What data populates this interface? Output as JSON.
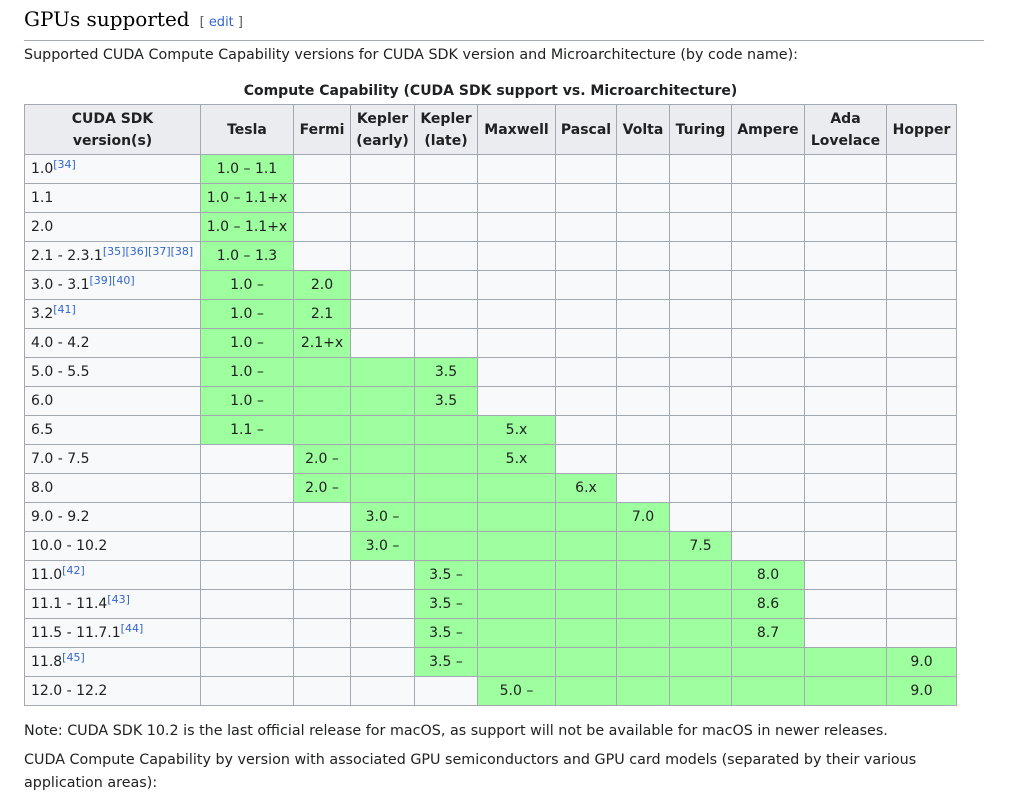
{
  "section": {
    "title": "GPUs supported",
    "edit_open": "[ ",
    "edit_label": "edit",
    "edit_close": " ]"
  },
  "intro": "Supported CUDA Compute Capability versions for CUDA SDK version and Microarchitecture (by code name):",
  "table": {
    "caption": "Compute Capability (CUDA SDK support vs. Microarchitecture)",
    "headers": [
      [
        "CUDA SDK",
        "version(s)"
      ],
      [
        "Tesla"
      ],
      [
        "Fermi"
      ],
      [
        "Kepler",
        "(early)"
      ],
      [
        "Kepler",
        "(late)"
      ],
      [
        "Maxwell"
      ],
      [
        "Pascal"
      ],
      [
        "Volta"
      ],
      [
        "Turing"
      ],
      [
        "Ampere"
      ],
      [
        "Ada",
        "Lovelace"
      ],
      [
        "Hopper"
      ]
    ],
    "highlight_color": "#9eff9e",
    "rows": [
      {
        "version": "1.0",
        "refs": [
          "[34]"
        ],
        "cells": [
          [
            "1.0 – 1.1",
            1,
            true
          ]
        ],
        "empty_after": 10
      },
      {
        "version": "1.1",
        "refs": [],
        "cells": [
          [
            "1.0 – 1.1+x",
            1,
            true
          ]
        ],
        "empty_after": 10
      },
      {
        "version": "2.0",
        "refs": [],
        "cells": [
          [
            "1.0 – 1.1+x",
            1,
            true
          ]
        ],
        "empty_after": 10
      },
      {
        "version": "2.1 - 2.3.1",
        "refs": [
          "[35]",
          "[36]",
          "[37]",
          "[38]"
        ],
        "cells": [
          [
            "1.0 – 1.3",
            1,
            true
          ]
        ],
        "empty_after": 10
      },
      {
        "version": "3.0 - 3.1",
        "refs": [
          "[39]",
          "[40]"
        ],
        "cells": [
          [
            "1.0 –",
            1,
            true
          ],
          [
            "2.0",
            1,
            true
          ]
        ],
        "empty_after": 9
      },
      {
        "version": "3.2",
        "refs": [
          "[41]"
        ],
        "cells": [
          [
            "1.0 –",
            1,
            true
          ],
          [
            "2.1",
            1,
            true
          ]
        ],
        "empty_after": 9
      },
      {
        "version": "4.0 - 4.2",
        "refs": [],
        "cells": [
          [
            "1.0 –",
            1,
            true
          ],
          [
            "2.1+x",
            1,
            true
          ]
        ],
        "empty_after": 9
      },
      {
        "version": "5.0 - 5.5",
        "refs": [],
        "cells": [
          [
            "1.0 –",
            1,
            true
          ],
          [
            "",
            2,
            true
          ],
          [
            "3.5",
            1,
            true
          ]
        ],
        "empty_after": 7
      },
      {
        "version": "6.0",
        "refs": [],
        "cells": [
          [
            "1.0 –",
            1,
            true
          ],
          [
            "",
            2,
            true
          ],
          [
            "3.5",
            1,
            true
          ]
        ],
        "empty_after": 7
      },
      {
        "version": "6.5",
        "refs": [],
        "cells": [
          [
            "1.1 –",
            1,
            true
          ],
          [
            "",
            3,
            true
          ],
          [
            "5.x",
            1,
            true
          ]
        ],
        "empty_after": 6
      },
      {
        "version": "7.0 - 7.5",
        "refs": [],
        "cells": [
          [
            "",
            1,
            false
          ],
          [
            "2.0 –",
            1,
            true
          ],
          [
            "",
            2,
            true
          ],
          [
            "5.x",
            1,
            true
          ]
        ],
        "empty_after": 6
      },
      {
        "version": "8.0",
        "refs": [],
        "cells": [
          [
            "",
            1,
            false
          ],
          [
            "2.0 –",
            1,
            true
          ],
          [
            "",
            3,
            true
          ],
          [
            "6.x",
            1,
            true
          ]
        ],
        "empty_after": 5
      },
      {
        "version": "9.0 - 9.2",
        "refs": [],
        "cells": [
          [
            "",
            2,
            false
          ],
          [
            "3.0 –",
            1,
            true
          ],
          [
            "",
            3,
            true
          ],
          [
            "7.0",
            1,
            true
          ]
        ],
        "empty_after": 4
      },
      {
        "version": "10.0 - 10.2",
        "refs": [],
        "cells": [
          [
            "",
            2,
            false
          ],
          [
            "3.0 –",
            1,
            true
          ],
          [
            "",
            4,
            true
          ],
          [
            "7.5",
            1,
            true
          ]
        ],
        "empty_after": 3
      },
      {
        "version": "11.0",
        "refs": [
          "[42]"
        ],
        "cells": [
          [
            "",
            3,
            false
          ],
          [
            "3.5 –",
            1,
            true
          ],
          [
            "",
            4,
            true
          ],
          [
            "8.0",
            1,
            true
          ]
        ],
        "empty_after": 2
      },
      {
        "version": "11.1 - 11.4",
        "refs": [
          "[43]"
        ],
        "cells": [
          [
            "",
            3,
            false
          ],
          [
            "3.5 –",
            1,
            true
          ],
          [
            "",
            4,
            true
          ],
          [
            "8.6",
            1,
            true
          ]
        ],
        "empty_after": 2
      },
      {
        "version": "11.5 - 11.7.1",
        "refs": [
          "[44]"
        ],
        "cells": [
          [
            "",
            3,
            false
          ],
          [
            "3.5 –",
            1,
            true
          ],
          [
            "",
            4,
            true
          ],
          [
            "8.7",
            1,
            true
          ]
        ],
        "empty_after": 2
      },
      {
        "version": "11.8",
        "refs": [
          "[45]"
        ],
        "cells": [
          [
            "",
            3,
            false
          ],
          [
            "3.5 –",
            1,
            true
          ],
          [
            "",
            6,
            true
          ],
          [
            "9.0",
            1,
            true
          ]
        ],
        "empty_after": 0
      },
      {
        "version": "12.0 - 12.2",
        "refs": [],
        "cells": [
          [
            "",
            4,
            false
          ],
          [
            "5.0 –",
            1,
            true
          ],
          [
            "",
            5,
            true
          ],
          [
            "9.0",
            1,
            true
          ]
        ],
        "empty_after": 0
      }
    ]
  },
  "note": "Note: CUDA SDK 10.2 is the last official release for macOS, as support will not be available for macOS in newer releases.",
  "note2": "CUDA Compute Capability by version with associated GPU semiconductors and GPU card models (separated by their various application areas):"
}
